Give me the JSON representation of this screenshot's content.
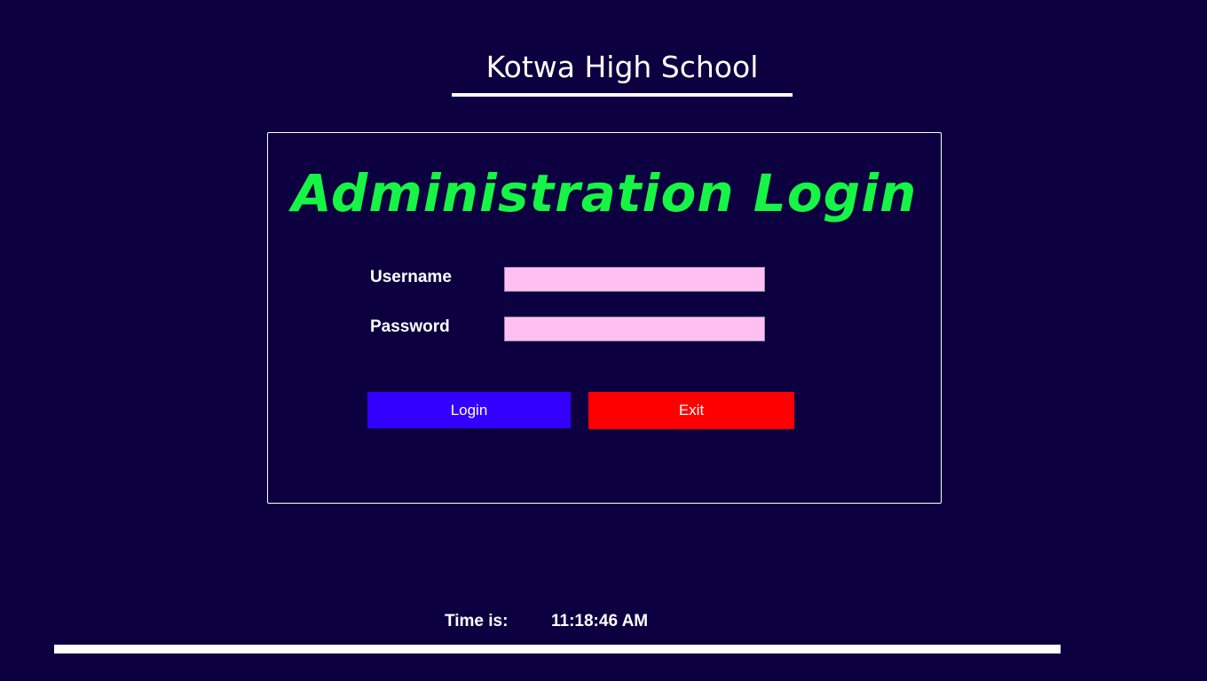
{
  "header": {
    "school_name": "Kotwa High School"
  },
  "login_panel": {
    "heading": "Administration Login",
    "username_label": "Username",
    "username_value": "",
    "password_label": "Password",
    "password_value": "",
    "login_button": "Login",
    "exit_button": "Exit"
  },
  "footer": {
    "time_label": "Time is:",
    "time_value": "11:18:46 AM",
    "progress_fraction": 1.0
  },
  "colors": {
    "background": "#0c0040",
    "heading": "#16f545",
    "input_background": "#ffc0f0",
    "login_button": "#3300ff",
    "exit_button": "#ff0000"
  }
}
